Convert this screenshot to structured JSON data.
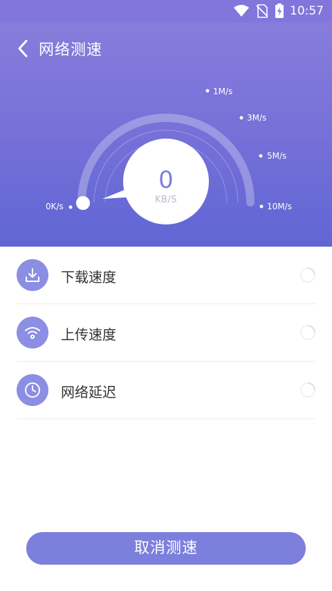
{
  "status_bar": {
    "time": "10:57",
    "icons": [
      "wifi-icon",
      "no-sim-icon",
      "battery-charging-icon"
    ]
  },
  "header": {
    "title": "网络测速",
    "back_icon": "chevron-left-icon"
  },
  "gauge": {
    "value": "0",
    "unit": "KB/S",
    "progress": 0,
    "scale_labels": [
      "0K/s",
      "1M/s",
      "3M/s",
      "5M/s",
      "10M/s"
    ]
  },
  "tests": [
    {
      "icon": "download-icon",
      "label": "下载速度"
    },
    {
      "icon": "wifi-icon",
      "label": "上传速度"
    },
    {
      "icon": "clock-icon",
      "label": "网络延迟"
    }
  ],
  "actions": {
    "cancel_label": "取消测速"
  },
  "colors": {
    "accent": "#7c7fdb",
    "header_top": "#8a7fdc",
    "header_bottom": "#5f66d4",
    "icon_bg": "#8b8ee3"
  }
}
